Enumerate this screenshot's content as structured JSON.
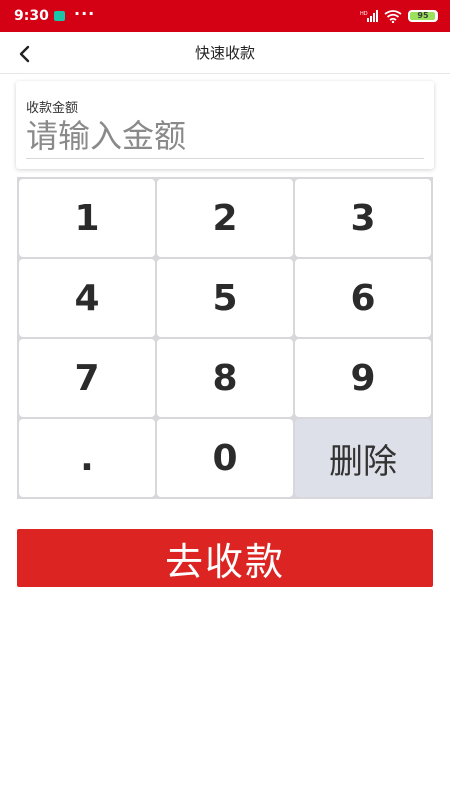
{
  "status_bar": {
    "time": "9:30",
    "dots": "···",
    "battery_level": "95",
    "battery_fraction": 0.95,
    "app_icon_color": "#19c5a8",
    "background_color": "#d40014"
  },
  "nav": {
    "back_icon": "chevron-left-icon",
    "title": "快速收款"
  },
  "amount": {
    "label": "收款金额",
    "placeholder": "请输入金额",
    "value": ""
  },
  "keypad": {
    "keys": [
      "1",
      "2",
      "3",
      "4",
      "5",
      "6",
      "7",
      "8",
      "9",
      ".",
      "0",
      "删除"
    ],
    "delete_background": "#dde0e8"
  },
  "submit": {
    "label": "去收款",
    "color": "#dc2523"
  }
}
